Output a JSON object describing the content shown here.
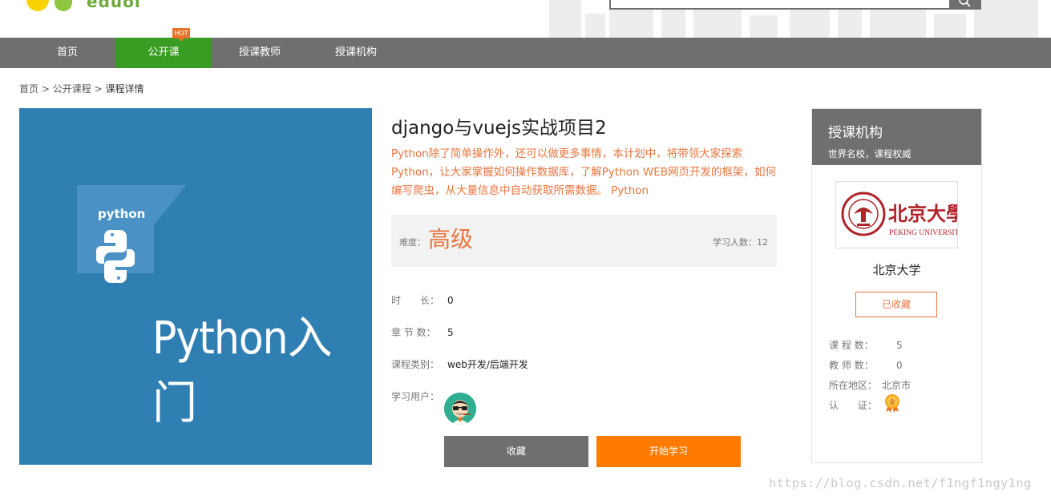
{
  "header": {
    "logo_text": "eduol",
    "search_placeholder": ""
  },
  "nav": {
    "items": [
      {
        "label": "首页"
      },
      {
        "label": "公开课",
        "badge": "HOT"
      },
      {
        "label": "授课教师"
      },
      {
        "label": "授课机构"
      }
    ],
    "active_index": 1
  },
  "breadcrumb": {
    "items": [
      "首页",
      "公开课程",
      "课程详情"
    ],
    "separator": ">"
  },
  "course": {
    "cover": {
      "badge_text": "python",
      "title_text": "Python入门"
    },
    "title": "django与vuejs实战项目2",
    "description": "Python除了简单操作外，还可以做更多事情，本计划中，将带领大家探索Python，让大家掌握如何操作数据库，了解Python WEB网页开发的框架，如何编写爬虫，从大量信息中自动获取所需数据。 Python",
    "difficulty_label": "难度：",
    "difficulty_value": "高级",
    "learners_label": "学习人数：",
    "learners_value": "12",
    "duration_label": "时　　长：",
    "duration_value": "0",
    "chapters_label": "章 节 数：",
    "chapters_value": "5",
    "category_label": "课程类别：",
    "category_value": "web开发/后端开发",
    "users_label": "学习用户：",
    "favorite_button": "收藏",
    "start_button": "开始学习"
  },
  "org": {
    "title": "授课机构",
    "subtitle": "世界名校，课程权威",
    "logo_cn": "北京大學",
    "logo_en": "PEKING UNIVERSITY",
    "name": "北京大学",
    "collect_button": "已收藏",
    "course_count_label": "课 程 数：",
    "course_count_value": "5",
    "teacher_count_label": "教 师 数：",
    "teacher_count_value": "0",
    "region_label": "所在地区：",
    "region_value": "北京市",
    "cert_label": "认　　证：",
    "cert_icon": "gold-medal-icon"
  },
  "watermark": "https://blog.csdn.net/f1ngf1ngy1ng",
  "colors": {
    "nav_bg": "#6f6f6f",
    "nav_active": "#3a9d23",
    "accent_orange": "#ff7a00",
    "desc_orange": "#e8753e",
    "cover_blue": "#2f7fb3"
  }
}
